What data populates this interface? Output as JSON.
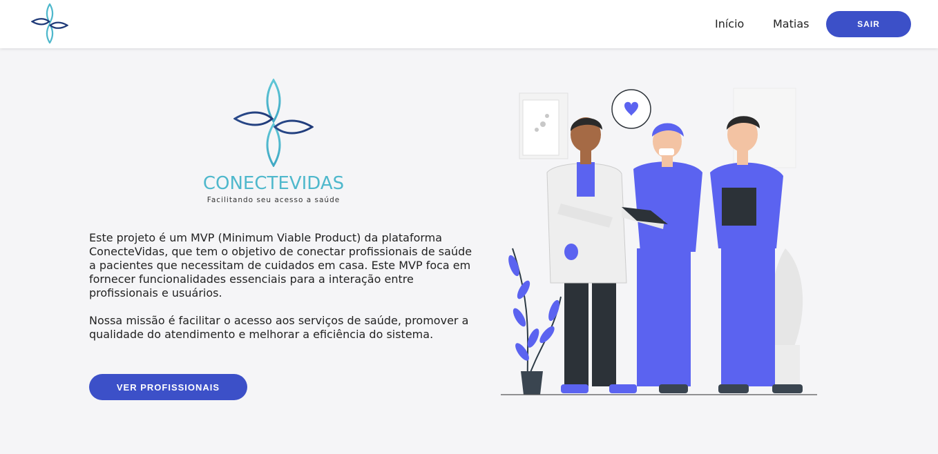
{
  "header": {
    "nav": {
      "home_label": "Início",
      "user_label": "Matias"
    },
    "logout_label": "SAIR"
  },
  "hero": {
    "brand_name": "CONECTEVIDAS",
    "tagline": "Facilitando seu acesso a saúde",
    "paragraphs": [
      "Este projeto é um MVP (Minimum Viable Product) da plataforma ConecteVidas, que tem o objetivo de conectar profissionais de saúde a pacientes que necessitam de cuidados em casa. Este MVP foca em fornecer funcionalidades essenciais para a interação entre profissionais e usuários.",
      "Nossa missão é facilitar o acesso aos serviços de saúde, promover a qualidade do atendimento e melhorar a eficiência do sistema."
    ],
    "cta_label": "VER PROFISSIONAIS"
  },
  "colors": {
    "primary": "#3c50c8",
    "brand_teal": "#4fb8cc",
    "brand_navy": "#1f3a78",
    "scrub": "#5b63f0",
    "background": "#f5f5f7"
  },
  "icons": {
    "logo": "four-petal-cross-logo",
    "illustration": "healthcare-team-illustration"
  }
}
